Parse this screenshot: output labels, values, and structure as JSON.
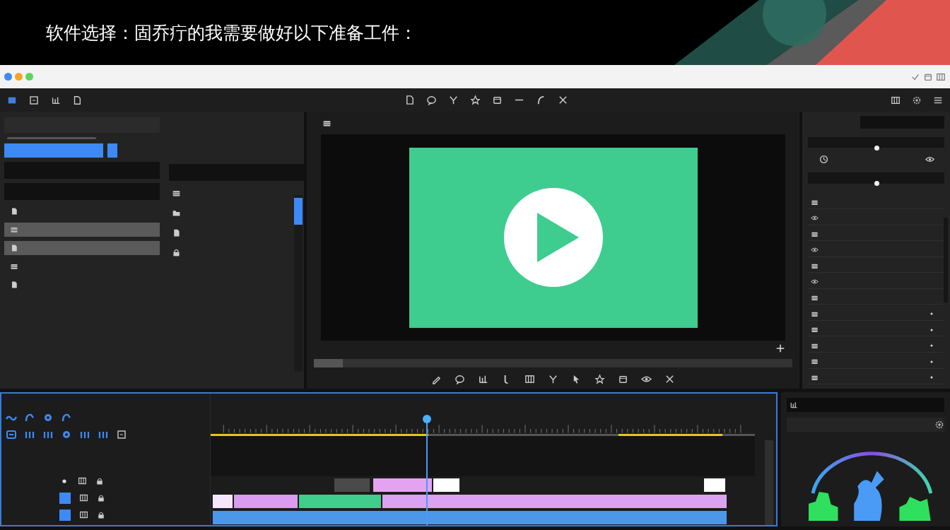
{
  "banner": {
    "subtitle": "软件选择：固乔疔的我需要做好以下准备工件："
  },
  "window": {
    "buttons": [
      {
        "color": "#3d8af7"
      },
      {
        "color": "#f5a524"
      },
      {
        "color": "#5fd35f"
      }
    ]
  },
  "media_panel": {
    "items": [
      {
        "selected": false
      },
      {
        "selected": true
      },
      {
        "selected": true
      },
      {
        "selected": false
      },
      {
        "selected": false
      }
    ]
  },
  "preview": {
    "scrubber": {
      "level": 0.06
    }
  },
  "inspector": {
    "sliders": [
      {
        "level": 0.5
      },
      {
        "level": 0.5
      }
    ]
  },
  "timeline": {
    "playhead": {
      "level": 0.397
    },
    "tracks": [
      {
        "clips": [
          {
            "color": "#4a4a4a"
          },
          {
            "color": "#e3a3f0"
          },
          {
            "color": "#ffffff"
          },
          {
            "color": "#ffffff"
          }
        ]
      },
      {
        "clips": [
          {
            "color": "#f6e6fb"
          },
          {
            "color": "#d99cf0"
          },
          {
            "color": "#3fce8c"
          },
          {
            "color": "#dba2f2"
          }
        ]
      },
      {
        "clips": [
          {
            "color": "#4b97ea"
          }
        ]
      }
    ]
  }
}
